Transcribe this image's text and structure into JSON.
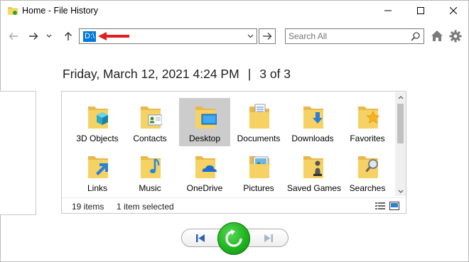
{
  "window": {
    "title": "Home - File History",
    "controls": {
      "minimize": "minimize-icon",
      "maximize": "maximize-icon",
      "close": "close-icon"
    }
  },
  "nav": {
    "back": "back-arrow-icon",
    "forward": "forward-arrow-icon",
    "recent": "chevron-down-icon",
    "up": "up-arrow-icon",
    "address_value": "D:\\",
    "go": "go-arrow-icon",
    "search_placeholder": "Search All",
    "home": "home-icon",
    "settings": "gear-icon"
  },
  "snapshot": {
    "date": "Friday, March 12, 2021 4:24 PM",
    "separator": "|",
    "position": "3 of 3"
  },
  "items": [
    {
      "label": "3D Objects",
      "icon": "folder-3d-objects-icon",
      "selected": false
    },
    {
      "label": "Contacts",
      "icon": "folder-contacts-icon",
      "selected": false
    },
    {
      "label": "Desktop",
      "icon": "folder-desktop-icon",
      "selected": true
    },
    {
      "label": "Documents",
      "icon": "folder-documents-icon",
      "selected": false
    },
    {
      "label": "Downloads",
      "icon": "folder-downloads-icon",
      "selected": false
    },
    {
      "label": "Favorites",
      "icon": "folder-favorites-icon",
      "selected": false
    },
    {
      "label": "Links",
      "icon": "folder-links-icon",
      "selected": false
    },
    {
      "label": "Music",
      "icon": "folder-music-icon",
      "selected": false
    },
    {
      "label": "OneDrive",
      "icon": "folder-onedrive-icon",
      "selected": false
    },
    {
      "label": "Pictures",
      "icon": "folder-pictures-icon",
      "selected": false
    },
    {
      "label": "Saved Games",
      "icon": "folder-saved-games-icon",
      "selected": false
    },
    {
      "label": "Searches",
      "icon": "folder-searches-icon",
      "selected": false
    }
  ],
  "status": {
    "item_count": "19 items",
    "selection": "1 item selected"
  },
  "colors": {
    "selection": "#0078d7",
    "annotation_arrow": "#e01f1f",
    "restore_green": "#20b420",
    "folder": "#f6d163"
  }
}
